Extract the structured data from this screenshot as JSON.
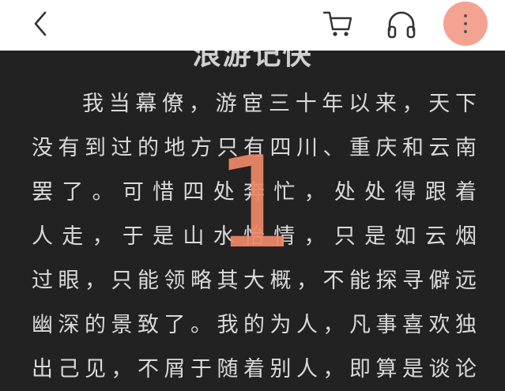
{
  "header": {
    "icons": {
      "back": "back-chevron-icon",
      "cart": "shopping-cart-icon",
      "audio": "headphones-icon",
      "more": "more-vertical-icon"
    },
    "more_button_color": "#f4a391"
  },
  "reader": {
    "chapter_title_partial": "浪游记快",
    "lines": [
      "我当幕僚，游宦三十年以来，天下",
      "没有到过的地方只有四川、重庆和云南",
      "罢了。可惜四处奔忙，处处得跟着",
      "人走，于是山水怡情，只是如云烟",
      "过眼，只能领略其大概，不能探寻僻远",
      "幽深的景致了。我的为人，凡事喜欢独",
      "出己见，不屑于随着别人，即算是谈论"
    ],
    "page_number": "1",
    "page_number_color": "#f08868",
    "background_color": "#222222",
    "text_color": "#dadada"
  }
}
